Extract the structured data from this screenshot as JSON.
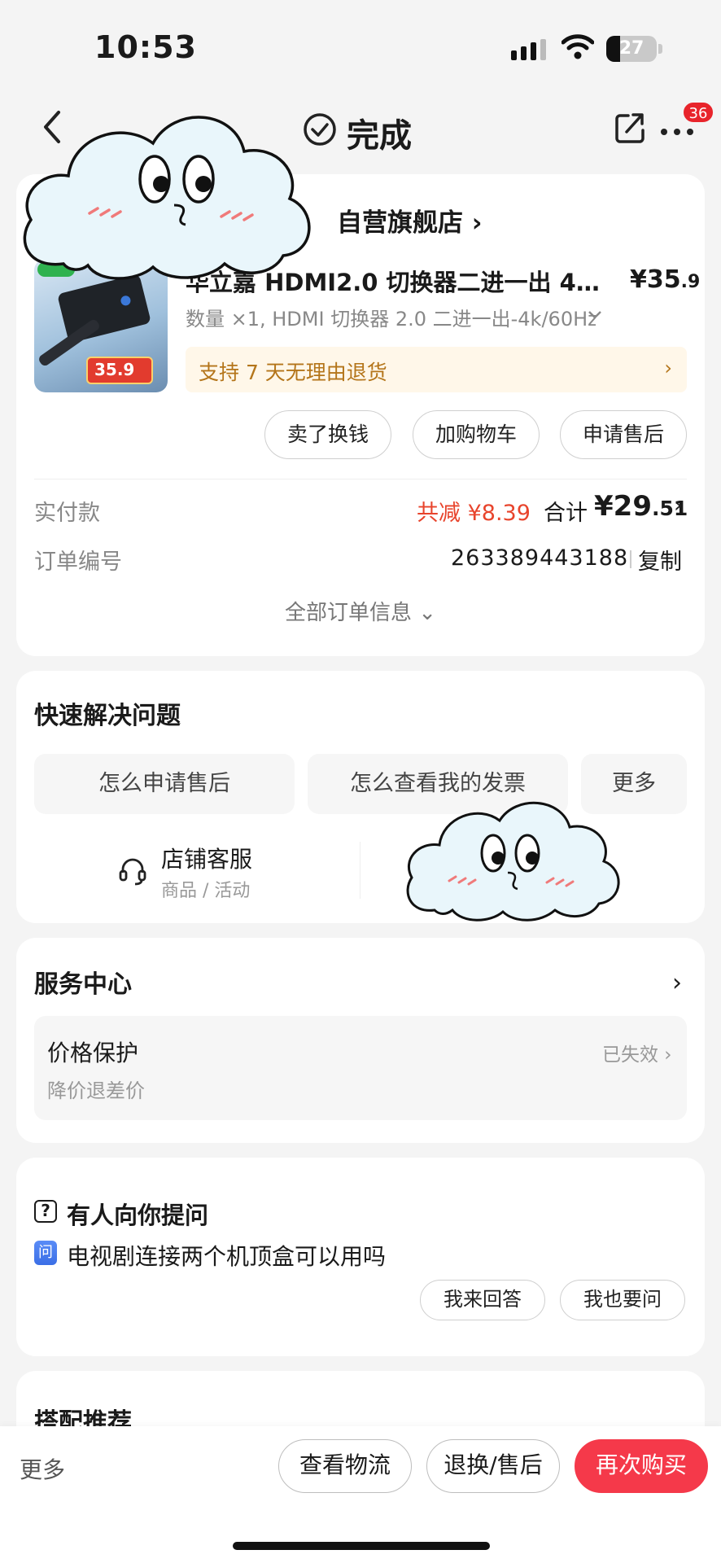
{
  "status_bar": {
    "time": "10:53",
    "battery": "27"
  },
  "nav": {
    "title": "完成",
    "badge": "36"
  },
  "order": {
    "store": "自营旗舰店 ›",
    "product_title": "华立嘉 HDMI2.0 切换器二进一出 4K/...",
    "price_main": "¥35",
    "price_decimal": ".9",
    "thumb_price": "35.9",
    "spec": "数量 ×1, HDMI 切换器 2.0 二进一出-4k/60Hz",
    "return_policy": "支持 7 天无理由退货",
    "actions": [
      "卖了换钱",
      "加购物车",
      "申请售后"
    ],
    "paid_label": "实付款",
    "discount": "共减 ¥8.39",
    "total_label": "合计",
    "total_main": "¥29",
    "total_decimal": ".51",
    "order_no_label": "订单编号",
    "order_no": "263389443188",
    "copy": "复制",
    "all_info": "全部订单信息 ⌄"
  },
  "quick_solve": {
    "title": "快速解决问题",
    "chips": [
      "怎么申请售后",
      "怎么查看我的发票",
      "更多"
    ],
    "cs_title": "店铺客服",
    "cs_sub": "商品 / 活动"
  },
  "service": {
    "title": "服务中心",
    "item_title": "价格保护",
    "item_sub": "降价退差价",
    "item_status": "已失效 ›"
  },
  "question": {
    "title": "有人向你提问",
    "tag": "问",
    "text": "电视剧连接两个机顶盒可以用吗",
    "answer": "我来回答",
    "ask": "我也要问"
  },
  "recommend": {
    "title": "搭配推荐"
  },
  "bottom_bar": {
    "more": "更多",
    "logistics": "查看物流",
    "after_sale": "退换/售后",
    "rebuy": "再次购买"
  },
  "colors": {
    "accent": "#f5394a",
    "discount": "#e8442c",
    "return_text": "#b4751a"
  }
}
